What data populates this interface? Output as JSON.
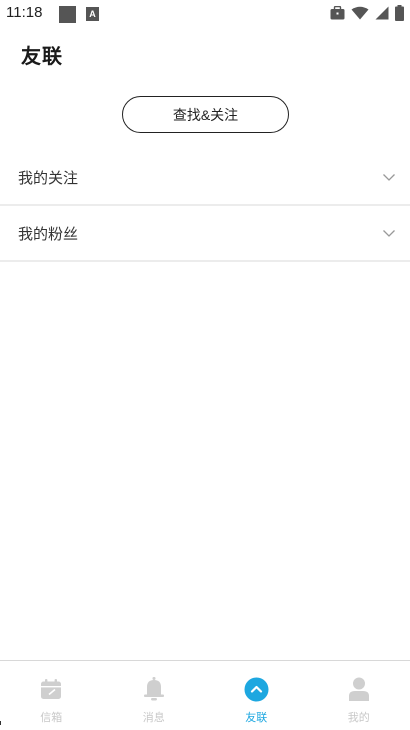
{
  "status_bar": {
    "time": "11:18",
    "a_icon_letter": "A",
    "icons": [
      "square-notification-icon",
      "a-notification-icon",
      "briefcase-icon",
      "wifi-icon",
      "signal-icon",
      "battery-icon"
    ]
  },
  "header": {
    "title": "友联"
  },
  "actions": {
    "find_follow_label": "查找&关注"
  },
  "sections": [
    {
      "label": "我的关注",
      "icon": "chevron-down-icon"
    },
    {
      "label": "我的粉丝",
      "icon": "chevron-down-icon"
    }
  ],
  "bottom_nav": {
    "items": [
      {
        "label": "信箱",
        "icon": "calendar-inbox-icon",
        "active": false
      },
      {
        "label": "消息",
        "icon": "bell-icon",
        "active": false
      },
      {
        "label": "友联",
        "icon": "chevron-up-circle-icon",
        "active": true
      },
      {
        "label": "我的",
        "icon": "person-icon",
        "active": false
      }
    ]
  },
  "colors": {
    "accent": "#1da7e0",
    "inactive": "#c8c8c8",
    "divider": "#ececec",
    "text": "#1a1a1a"
  }
}
